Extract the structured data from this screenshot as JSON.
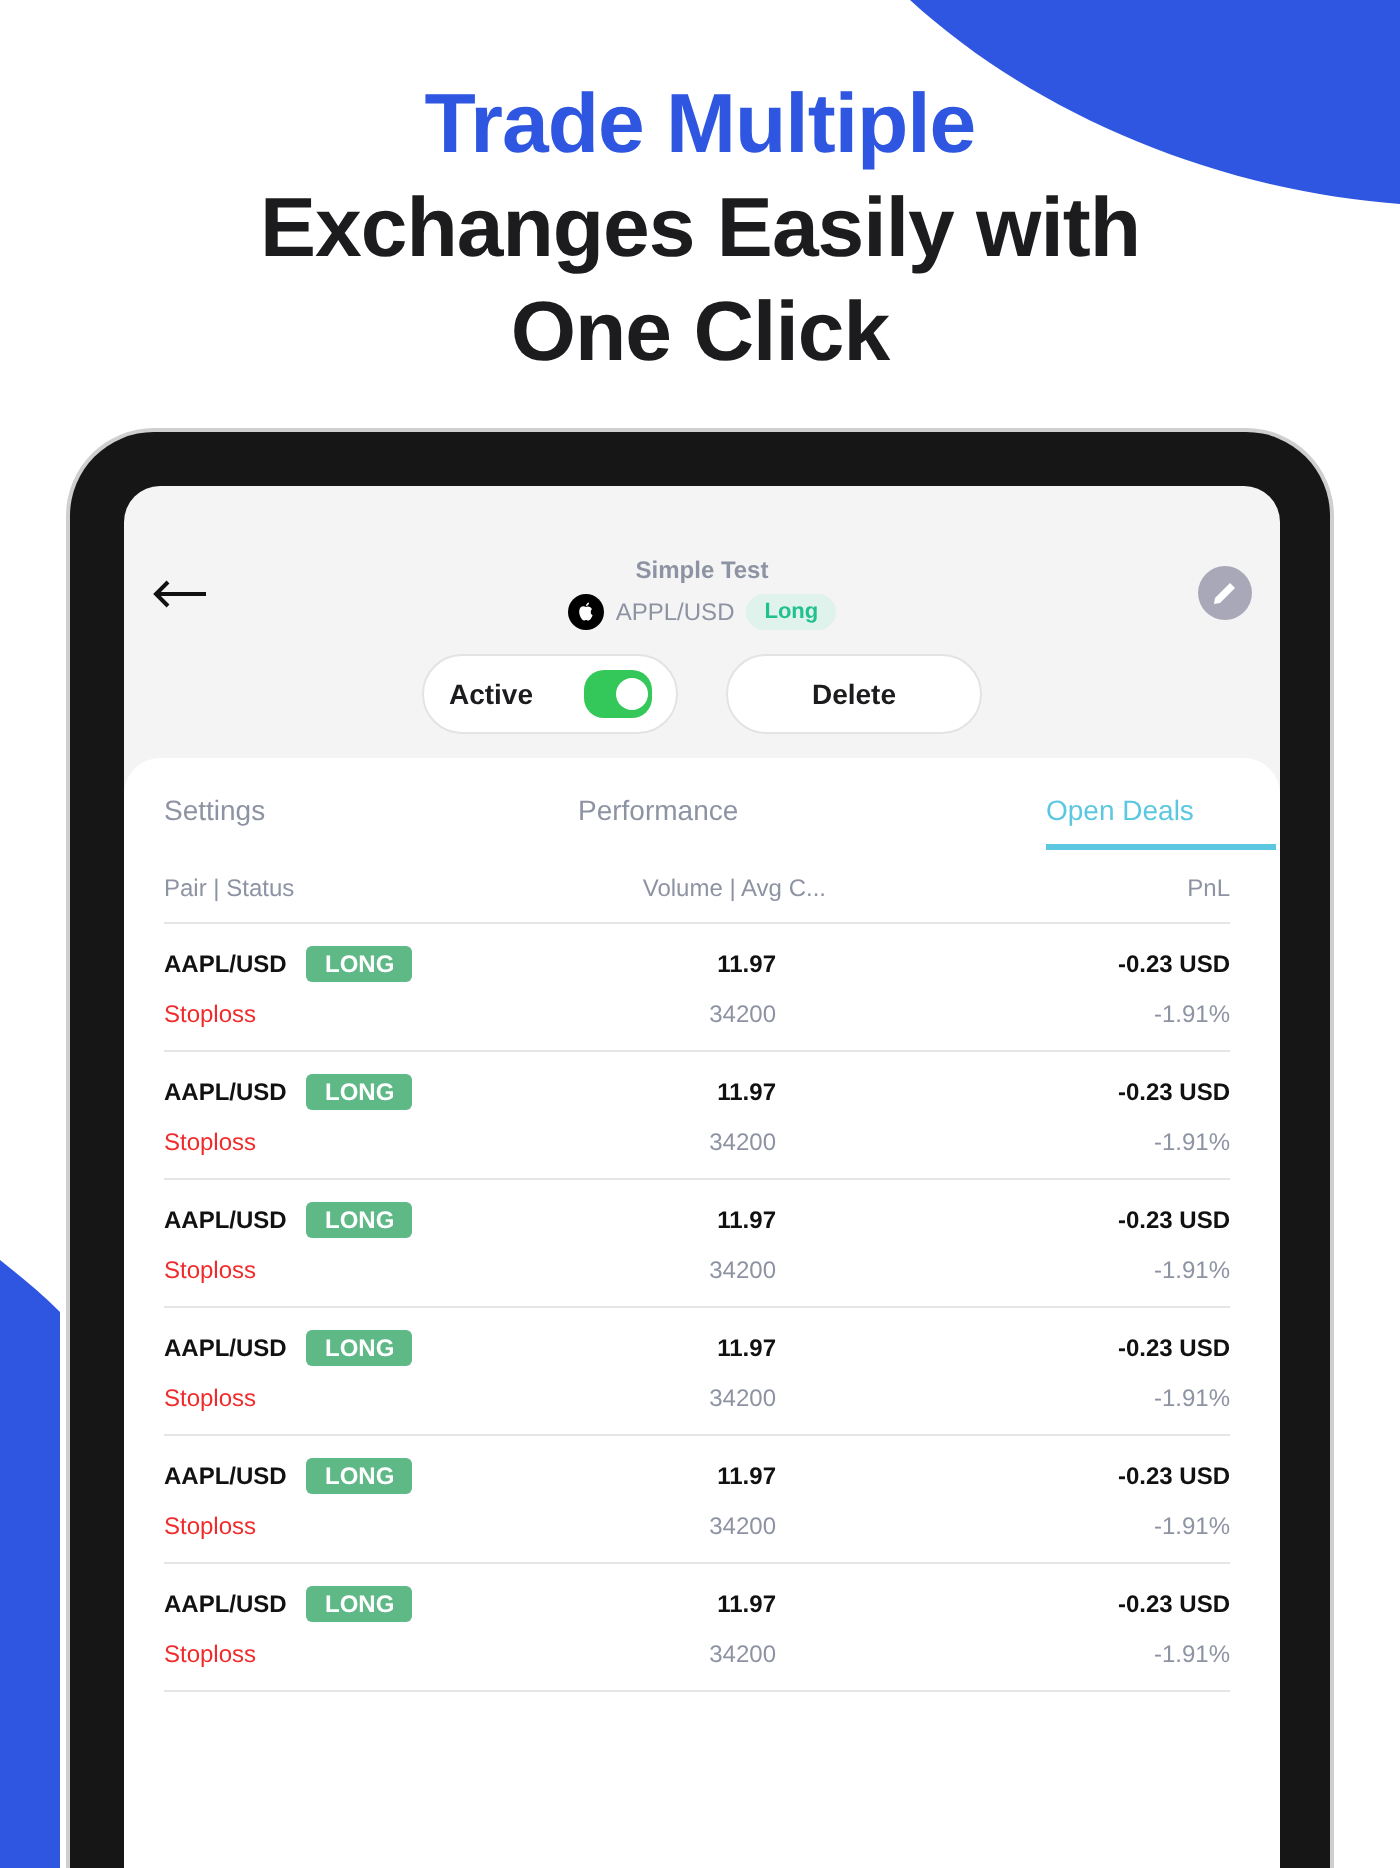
{
  "headline": [
    {
      "text": "Trade Multiple",
      "accent": true
    },
    {
      "text": "Exchanges Easily with",
      "accent": false
    },
    {
      "text": "One Click",
      "accent": false
    }
  ],
  "header": {
    "title": "Simple Test",
    "pair": "APPL/USD",
    "side": "Long"
  },
  "active_toggle": {
    "label": "Active",
    "on": true
  },
  "delete_button": "Delete",
  "tabs": [
    {
      "label": "Settings",
      "selected": false
    },
    {
      "label": "Performance",
      "selected": false
    },
    {
      "label": "Open Deals",
      "selected": true
    }
  ],
  "table": {
    "columns": [
      "Pair | Status",
      "Volume | Avg C...",
      "PnL"
    ],
    "rows": [
      {
        "pair": "AAPL/USD",
        "side": "LONG",
        "status": "Stoploss",
        "volume": "11.97",
        "avg": "34200",
        "pnl": "-0.23 USD",
        "pnl_pct": "-1.91%"
      },
      {
        "pair": "AAPL/USD",
        "side": "LONG",
        "status": "Stoploss",
        "volume": "11.97",
        "avg": "34200",
        "pnl": "-0.23 USD",
        "pnl_pct": "-1.91%"
      },
      {
        "pair": "AAPL/USD",
        "side": "LONG",
        "status": "Stoploss",
        "volume": "11.97",
        "avg": "34200",
        "pnl": "-0.23 USD",
        "pnl_pct": "-1.91%"
      },
      {
        "pair": "AAPL/USD",
        "side": "LONG",
        "status": "Stoploss",
        "volume": "11.97",
        "avg": "34200",
        "pnl": "-0.23 USD",
        "pnl_pct": "-1.91%"
      },
      {
        "pair": "AAPL/USD",
        "side": "LONG",
        "status": "Stoploss",
        "volume": "11.97",
        "avg": "34200",
        "pnl": "-0.23 USD",
        "pnl_pct": "-1.91%"
      },
      {
        "pair": "AAPL/USD",
        "side": "LONG",
        "status": "Stoploss",
        "volume": "11.97",
        "avg": "34200",
        "pnl": "-0.23 USD",
        "pnl_pct": "-1.91%"
      }
    ]
  }
}
